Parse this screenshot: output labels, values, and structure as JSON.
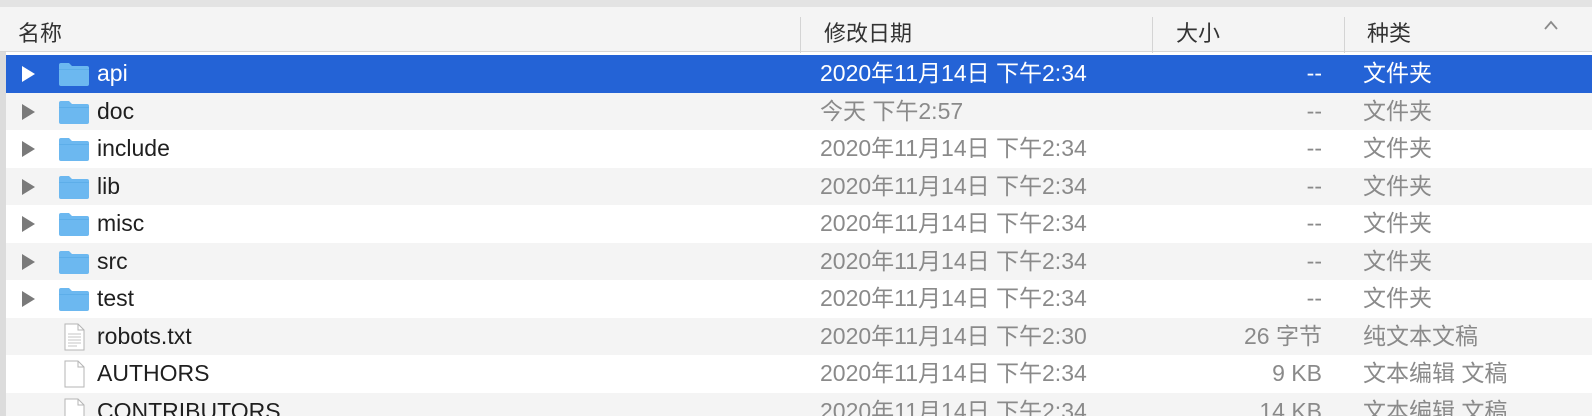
{
  "columns": {
    "name": "名称",
    "date": "修改日期",
    "size": "大小",
    "kind": "种类"
  },
  "rows": [
    {
      "name": "api",
      "date": "2020年11月14日 下午2:34",
      "size": "--",
      "kind": "文件夹",
      "type": "folder",
      "selected": true
    },
    {
      "name": "doc",
      "date": "今天 下午2:57",
      "size": "--",
      "kind": "文件夹",
      "type": "folder"
    },
    {
      "name": "include",
      "date": "2020年11月14日 下午2:34",
      "size": "--",
      "kind": "文件夹",
      "type": "folder"
    },
    {
      "name": "lib",
      "date": "2020年11月14日 下午2:34",
      "size": "--",
      "kind": "文件夹",
      "type": "folder"
    },
    {
      "name": "misc",
      "date": "2020年11月14日 下午2:34",
      "size": "--",
      "kind": "文件夹",
      "type": "folder"
    },
    {
      "name": "src",
      "date": "2020年11月14日 下午2:34",
      "size": "--",
      "kind": "文件夹",
      "type": "folder"
    },
    {
      "name": "test",
      "date": "2020年11月14日 下午2:34",
      "size": "--",
      "kind": "文件夹",
      "type": "folder"
    },
    {
      "name": "robots.txt",
      "date": "2020年11月14日 下午2:30",
      "size": "26 字节",
      "kind": "纯文本文稿",
      "type": "text-file"
    },
    {
      "name": "AUTHORS",
      "date": "2020年11月14日 下午2:34",
      "size": "9 KB",
      "kind": "文本编辑 文稿",
      "type": "blank-file"
    },
    {
      "name": "CONTRIBUTORS",
      "date": "2020年11月14日 下午2:34",
      "size": "14 KB",
      "kind": "文本编辑 文稿",
      "type": "blank-file"
    }
  ],
  "colors": {
    "selection": "#2463d6",
    "folder": "#6cb8f0",
    "alt_row": "#f4f4f4"
  }
}
